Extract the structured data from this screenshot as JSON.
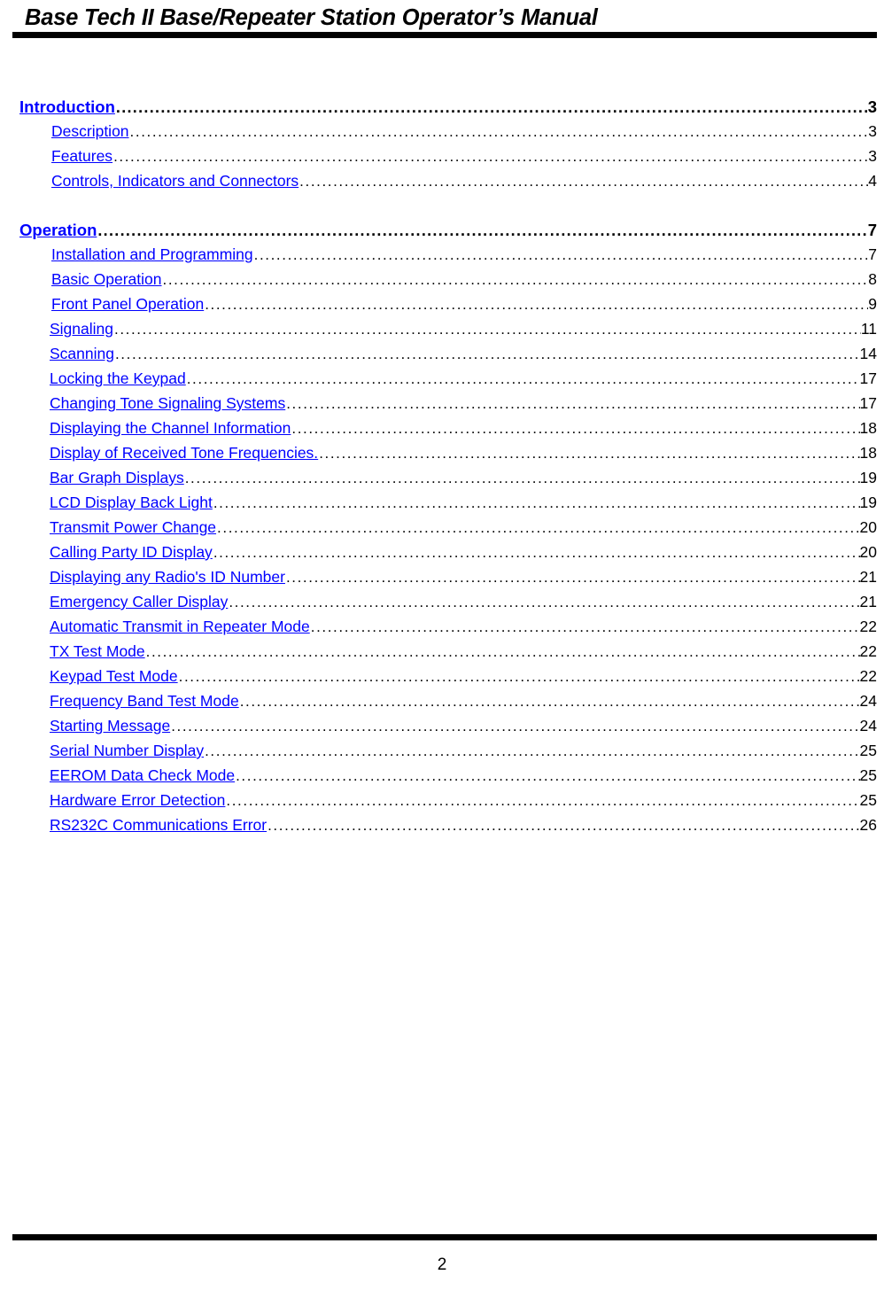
{
  "header": {
    "title": "Base Tech II Base/Repeater Station Operator’s Manual"
  },
  "footer": {
    "page_number": "2"
  },
  "colors": {
    "link": "#0000FF",
    "text": "#000000",
    "rule": "#000000",
    "background": "#FFFFFF"
  },
  "toc": {
    "entries": [
      {
        "level": 1,
        "label": "Introduction",
        "page": "3",
        "space_before": false
      },
      {
        "level": 2,
        "label": "Description",
        "page": "3",
        "space_before": false
      },
      {
        "level": 2,
        "label": "Features",
        "page": "3",
        "space_before": false
      },
      {
        "level": 2,
        "label": "Controls, Indicators and Connectors",
        "page": "4",
        "space_before": false
      },
      {
        "level": 1,
        "label": "Operation",
        "page": "7",
        "space_before": true
      },
      {
        "level": 2,
        "label": "Installation and Programming",
        "page": "7",
        "space_before": false
      },
      {
        "level": 2,
        "label": "Basic Operation",
        "page": "8",
        "space_before": false
      },
      {
        "level": 2,
        "label": "Front Panel Operation",
        "page": "9",
        "space_before": false
      },
      {
        "level": 3,
        "label": "Signaling",
        "page": "11",
        "space_before": false
      },
      {
        "level": 3,
        "label": "Scanning",
        "page": "14",
        "space_before": false
      },
      {
        "level": 3,
        "label": "Locking the Keypad",
        "page": "17",
        "space_before": false
      },
      {
        "level": 3,
        "label": "Changing Tone Signaling Systems",
        "page": "17",
        "space_before": false
      },
      {
        "level": 3,
        "label": "Displaying the Channel Information",
        "page": "18",
        "space_before": false
      },
      {
        "level": 3,
        "label": "Display of Received Tone Frequencies.",
        "page": "18",
        "space_before": false
      },
      {
        "level": 3,
        "label": "Bar Graph Displays",
        "page": "19",
        "space_before": false
      },
      {
        "level": 3,
        "label": "LCD Display Back Light",
        "page": "19",
        "space_before": false
      },
      {
        "level": 3,
        "label": "Transmit Power Change",
        "page": "20",
        "space_before": false
      },
      {
        "level": 3,
        "label": "Calling Party ID Display",
        "page": "20",
        "space_before": false
      },
      {
        "level": 3,
        "label": "Displaying any Radio's ID Number",
        "page": "21",
        "space_before": false
      },
      {
        "level": 3,
        "label": "Emergency Caller Display",
        "page": "21",
        "space_before": false
      },
      {
        "level": 3,
        "label": "Automatic Transmit in Repeater Mode",
        "page": "22",
        "space_before": false
      },
      {
        "level": 3,
        "label": "TX Test Mode",
        "page": "22",
        "space_before": false
      },
      {
        "level": 3,
        "label": "Keypad Test Mode",
        "page": "22",
        "space_before": false
      },
      {
        "level": 3,
        "label": "Frequency Band Test Mode",
        "page": "24",
        "space_before": false
      },
      {
        "level": 3,
        "label": "Starting Message",
        "page": "24",
        "space_before": false
      },
      {
        "level": 3,
        "label": "Serial Number Display",
        "page": "25",
        "space_before": false
      },
      {
        "level": 3,
        "label": "EEROM Data Check Mode",
        "page": "25",
        "space_before": false
      },
      {
        "level": 3,
        "label": "Hardware Error Detection",
        "page": "25",
        "space_before": false
      },
      {
        "level": 3,
        "label": "RS232C Communications Error",
        "page": "26",
        "space_before": false
      }
    ]
  }
}
